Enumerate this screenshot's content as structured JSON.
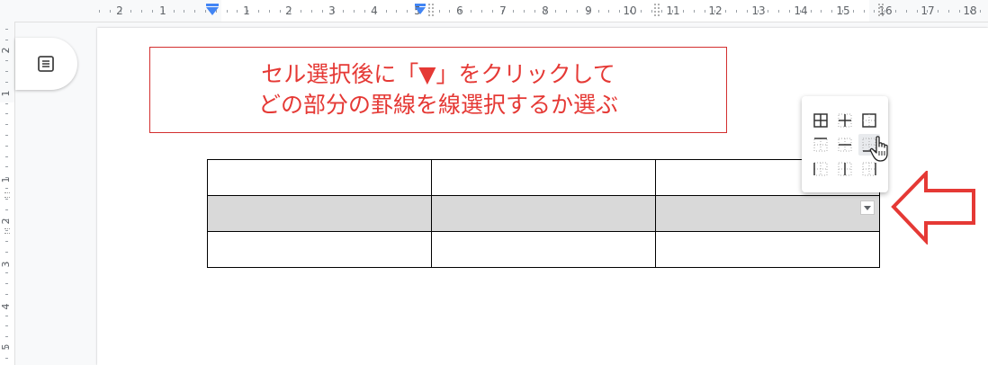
{
  "ruler": {
    "top_numbers": [
      "2",
      "1",
      "1",
      "2",
      "3",
      "4",
      "5",
      "6",
      "7",
      "8",
      "9",
      "10",
      "11",
      "12",
      "13",
      "14",
      "15",
      "16",
      "17",
      "18"
    ],
    "left_numbers": [
      "2",
      "1",
      "1",
      "2",
      "3",
      "4",
      "5"
    ]
  },
  "outline_button": {
    "icon": "outline-list-icon"
  },
  "callout": {
    "line1": "セル選択後に「▼」をクリックして",
    "line2": "どの部分の罫線を線選択するか選ぶ",
    "color": "#e53935"
  },
  "table": {
    "rows": 3,
    "cols": 3,
    "selected_row": 1
  },
  "border_menu": {
    "options": [
      [
        "all-borders-icon",
        "inner-borders-icon",
        "outer-borders-icon"
      ],
      [
        "top-border-icon",
        "horizontal-inner-border-icon",
        "bottom-border-icon"
      ],
      [
        "left-border-icon",
        "vertical-inner-border-icon",
        "right-border-icon"
      ]
    ],
    "hovered": "bottom-border-icon"
  },
  "arrow": {
    "color": "#e53935"
  }
}
